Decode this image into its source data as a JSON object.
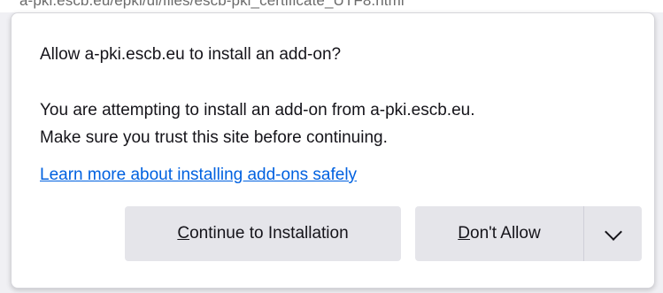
{
  "browser": {
    "urlbar_partial": "a-pki.escb.eu/epki/ui/files/escb-pki_certificate_UTF8.html"
  },
  "doorhanger": {
    "title": "Allow a-pki.escb.eu to install an add-on?",
    "message_line1": "You are attempting to install an add-on from a-pki.escb.eu.",
    "message_line2": "Make sure you trust this site before continuing.",
    "learn_more_link": "Learn more about installing add-ons safely",
    "buttons": {
      "continue": {
        "access_key": "C",
        "rest": "ontinue to Installation"
      },
      "dont_allow": {
        "access_key": "D",
        "rest": "on't Allow"
      },
      "dropdown_icon": "chevron-down-icon"
    }
  }
}
